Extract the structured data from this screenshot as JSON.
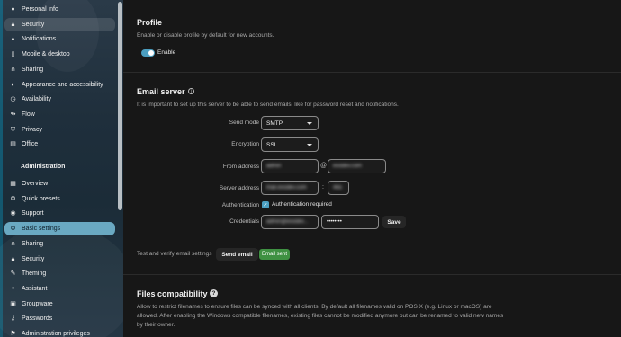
{
  "colors": {
    "accent": "#4b9ec0",
    "active_nav": "#6aa9c2",
    "success": "#3f9142",
    "background": "#171717"
  },
  "sidebar": {
    "personal_items": [
      {
        "label": "Personal info",
        "icon": "account-icon"
      },
      {
        "label": "Security",
        "icon": "lock-icon"
      },
      {
        "label": "Notifications",
        "icon": "bell-icon"
      },
      {
        "label": "Mobile & desktop",
        "icon": "cellphone-icon"
      },
      {
        "label": "Sharing",
        "icon": "share-icon"
      },
      {
        "label": "Appearance and accessibility",
        "icon": "palette-icon"
      },
      {
        "label": "Availability",
        "icon": "clock-icon"
      },
      {
        "label": "Flow",
        "icon": "flow-icon"
      },
      {
        "label": "Privacy",
        "icon": "shield-icon"
      },
      {
        "label": "Office",
        "icon": "document-icon"
      }
    ],
    "admin_heading": "Administration",
    "admin_items": [
      {
        "label": "Overview",
        "icon": "grid-icon"
      },
      {
        "label": "Quick presets",
        "icon": "presets-icon"
      },
      {
        "label": "Support",
        "icon": "support-icon"
      },
      {
        "label": "Basic settings",
        "icon": "gear-icon"
      },
      {
        "label": "Sharing",
        "icon": "share-icon"
      },
      {
        "label": "Security",
        "icon": "lock-icon"
      },
      {
        "label": "Theming",
        "icon": "brush-icon"
      },
      {
        "label": "Assistant",
        "icon": "assistant-icon"
      },
      {
        "label": "Groupware",
        "icon": "groupware-icon"
      },
      {
        "label": "Passwords",
        "icon": "key-icon"
      },
      {
        "label": "Administration privileges",
        "icon": "admin-icon"
      }
    ]
  },
  "profile": {
    "title": "Profile",
    "description": "Enable or disable profile by default for new accounts.",
    "toggle_label": "Enable"
  },
  "email_server": {
    "title": "Email server",
    "description": "It is important to set up this server to be able to send emails, like for password reset and notifications.",
    "send_mode_label": "Send mode",
    "send_mode_value": "SMTP",
    "encryption_label": "Encryption",
    "encryption_value": "SSL",
    "from_address_label": "From address",
    "from_user": "admin",
    "at_sign": "@",
    "from_domain": "exodev.com",
    "server_address_label": "Server address",
    "server_host": "mail.exodev.com",
    "colon": ":",
    "server_port": "465",
    "authentication_label": "Authentication",
    "auth_required_label": "Authentication required",
    "credentials_label": "Credentials",
    "credential_user": "admin@exodev...",
    "credential_password": "••••••••",
    "save_label": "Save",
    "test_label": "Test and verify email settings",
    "send_email_label": "Send email",
    "email_sent_label": "Email sent"
  },
  "files_compat": {
    "title": "Files compatibility",
    "description": "Allow to restrict filenames to ensure files can be synced with all clients. By default all filenames valid on POSIX (e.g. Linux or macOS) are allowed. After enabling the Windows compatible filenames, existing files cannot be modified anymore but can be renamed to valid new names by their owner."
  }
}
